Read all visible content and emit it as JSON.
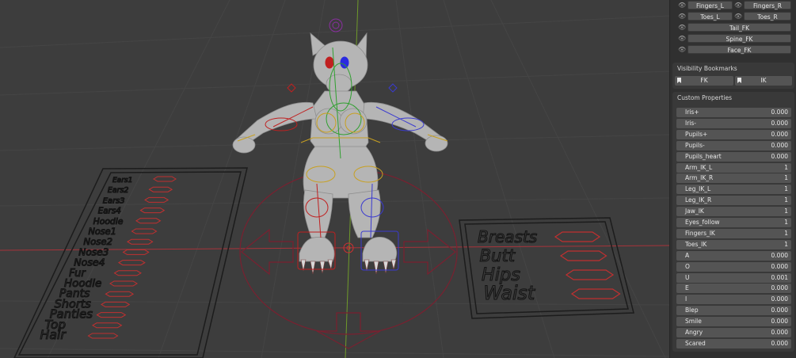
{
  "viewport": {
    "cage_left_labels": [
      "Ears1",
      "Ears2",
      "Ears3",
      "Ears4",
      "Hoodie",
      "Nose1",
      "Nose2",
      "Nose3",
      "Nose4",
      "Fur",
      "Hoodie",
      "Pants",
      "Shorts",
      "Panties",
      "Top",
      "Hair"
    ],
    "cage_right_labels": [
      "Breasts",
      "Butt",
      "Hips",
      "Waist"
    ]
  },
  "panel": {
    "visibility_rows": [
      {
        "left": "Fingers_L",
        "right": "Fingers_R"
      },
      {
        "left": "Toes_L",
        "right": "Toes_R"
      }
    ],
    "visibility_full_rows": [
      "Tail_FK",
      "Spine_FK",
      "Face_FK"
    ],
    "bookmarks_title": "Visibility Bookmarks",
    "bookmarks": [
      "FK",
      "IK"
    ],
    "custom_props_title": "Custom Properties",
    "properties": [
      {
        "name": "Iris+",
        "value": "0.000"
      },
      {
        "name": "Iris-",
        "value": "0.000"
      },
      {
        "name": "Pupils+",
        "value": "0.000"
      },
      {
        "name": "Pupils-",
        "value": "0.000"
      },
      {
        "name": "Pupils_heart",
        "value": "0.000"
      },
      {
        "name": "Arm_IK_L",
        "value": "1"
      },
      {
        "name": "Arm_IK_R",
        "value": "1"
      },
      {
        "name": "Leg_IK_L",
        "value": "1"
      },
      {
        "name": "Leg_IK_R",
        "value": "1"
      },
      {
        "name": "Jaw_IK",
        "value": "1"
      },
      {
        "name": "Eyes_follow",
        "value": "1"
      },
      {
        "name": "Fingers_IK",
        "value": "1"
      },
      {
        "name": "Toes_IK",
        "value": "1"
      },
      {
        "name": "A",
        "value": "0.000"
      },
      {
        "name": "O",
        "value": "0.000"
      },
      {
        "name": "U",
        "value": "0.001"
      },
      {
        "name": "E",
        "value": "0.000"
      },
      {
        "name": "I",
        "value": "0.000"
      },
      {
        "name": "Blep",
        "value": "0.000"
      },
      {
        "name": "Smile",
        "value": "0.000"
      },
      {
        "name": "Angry",
        "value": "0.000"
      },
      {
        "name": "Scared",
        "value": "0.000"
      }
    ]
  },
  "colors": {
    "viewport_bg": "#3d3d3d",
    "x_axis": "#a8333a",
    "y_axis": "#6f9a2a",
    "rig_red": "#c02020",
    "rig_blue": "#3a3ad0",
    "rig_yellow": "#c8a020",
    "rig_green": "#30a030",
    "rig_purple": "#8a2fa0"
  }
}
